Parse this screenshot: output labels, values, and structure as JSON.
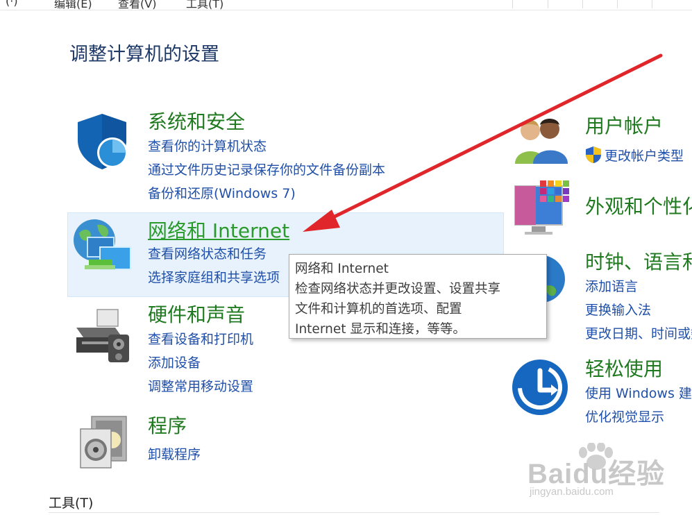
{
  "menu": {
    "items": [
      "(·)",
      "编辑(E)",
      "查看(V)",
      "工具(T)"
    ]
  },
  "page_title": "调整计算机的设置",
  "categories": {
    "system": {
      "title": "系统和安全",
      "links": [
        "查看你的计算机状态",
        "通过文件历史记录保存你的文件备份副本",
        "备份和还原(Windows 7)"
      ]
    },
    "network": {
      "title": "网络和 Internet",
      "links": [
        "查看网络状态和任务",
        "选择家庭组和共享选项"
      ]
    },
    "hardware": {
      "title": "硬件和声音",
      "links": [
        "查看设备和打印机",
        "添加设备",
        "调整常用移动设置"
      ]
    },
    "programs": {
      "title": "程序",
      "links": [
        "卸载程序"
      ]
    },
    "users": {
      "title": "用户帐户",
      "links": [
        "更改帐户类型"
      ]
    },
    "appearance": {
      "title": "外观和个性化",
      "links": []
    },
    "clock": {
      "title": "时钟、语言和区域",
      "links": [
        "添加语言",
        "更换输入法",
        "更改日期、时间或数字格式"
      ]
    },
    "ease": {
      "title": "轻松使用",
      "links": [
        "使用 Windows 建议的设置",
        "优化视觉显示"
      ]
    }
  },
  "tooltip": {
    "lines": [
      "网络和 Internet",
      "检查网络状态并更改设置、设置共享",
      "文件和计算机的首选项、配置",
      "Internet 显示和连接，等等。"
    ]
  },
  "tools_label": "工具(T)",
  "watermark": {
    "brand": "Baidu经验",
    "url": "jingyan.baidu.com"
  },
  "colors": {
    "category_title": "#1f7a1f",
    "link": "#1f4fa8",
    "highlight": "#e7f2fc",
    "arrow": "#e0262a"
  }
}
